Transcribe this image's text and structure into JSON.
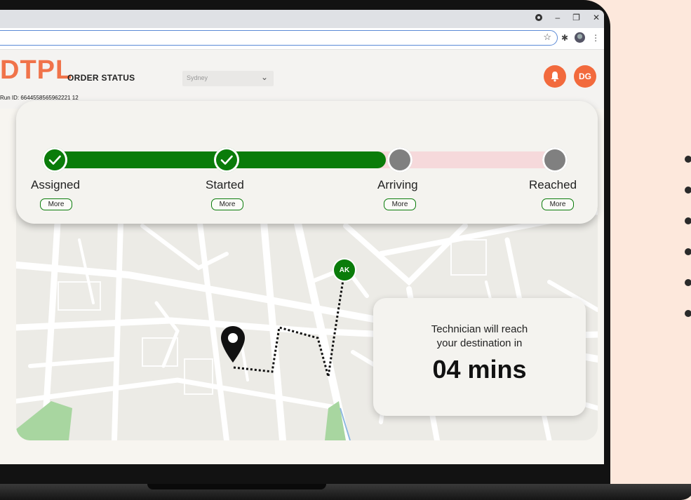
{
  "browser": {
    "window_controls": [
      "–",
      "❐",
      "✕"
    ]
  },
  "header": {
    "logo": "DTPL",
    "title": "ORDER STATUS",
    "run_id": "Run ID: 6644558565962221 12",
    "city": "Sydney",
    "notification_icon": "bell-icon",
    "user_initials": "DG"
  },
  "progress": {
    "completed_fraction": 0.66,
    "steps": [
      {
        "label": "Assigned",
        "more": "More",
        "status": "done"
      },
      {
        "label": "Started",
        "more": "More",
        "status": "done"
      },
      {
        "label": "Arriving",
        "more": "More",
        "status": "pending"
      },
      {
        "label": "Reached",
        "more": "More",
        "status": "pending"
      }
    ],
    "colors": {
      "done": "#0a7c0a",
      "pending": "#808080",
      "track": "#f6d9db"
    }
  },
  "map": {
    "technician_initials": "AK",
    "destination_icon": "map-pin-icon"
  },
  "eta": {
    "line1": "Technician will reach",
    "line2": "your destination in",
    "time": "04 mins"
  },
  "colors": {
    "accent": "#f26a3d",
    "brand": "#f0734a",
    "background": "#fde8dc"
  }
}
